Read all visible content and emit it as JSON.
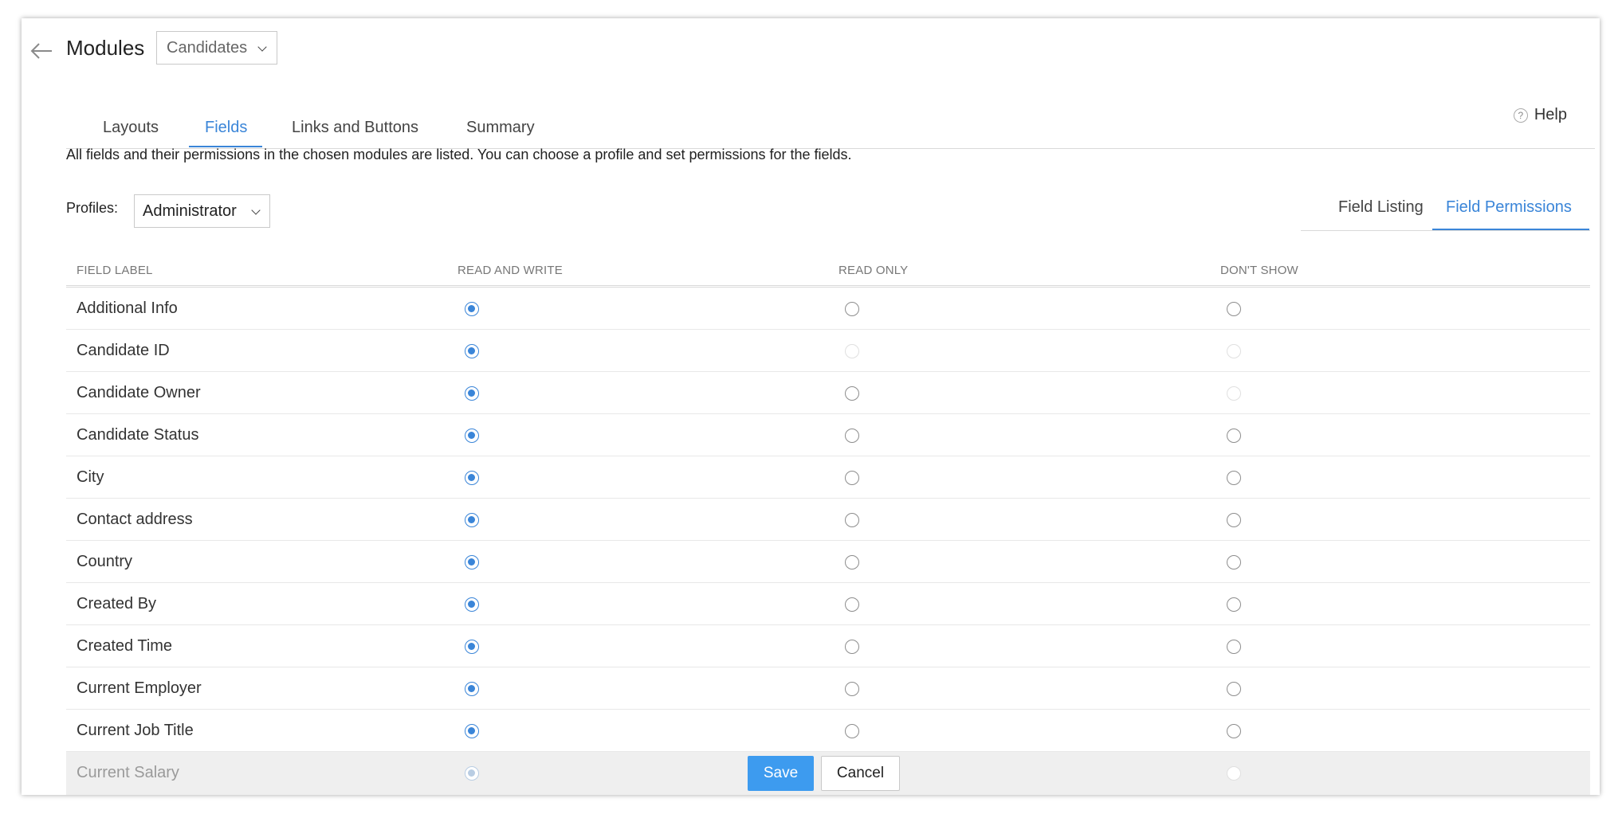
{
  "header": {
    "title": "Modules",
    "module_selected": "Candidates"
  },
  "tabs": [
    {
      "label": "Layouts",
      "active": false
    },
    {
      "label": "Fields",
      "active": true
    },
    {
      "label": "Links and Buttons",
      "active": false
    },
    {
      "label": "Summary",
      "active": false
    }
  ],
  "help": {
    "icon": "question-circle-icon",
    "label": "Help"
  },
  "description": "All fields and their permissions in the chosen modules are listed. You can choose a profile and set permissions for the fields.",
  "profiles": {
    "label": "Profiles:",
    "selected": "Administrator"
  },
  "view_toggle": [
    {
      "label": "Field Listing",
      "active": false
    },
    {
      "label": "Field Permissions",
      "active": true
    }
  ],
  "table": {
    "headers": [
      "FIELD LABEL",
      "READ AND WRITE",
      "READ ONLY",
      "DON'T SHOW"
    ],
    "rows": [
      {
        "label": "Additional Info",
        "selected": "read_write",
        "disabled": []
      },
      {
        "label": "Candidate ID",
        "selected": "read_write",
        "disabled": [
          "read_only",
          "dont_show"
        ]
      },
      {
        "label": "Candidate Owner",
        "selected": "read_write",
        "disabled": [
          "dont_show"
        ]
      },
      {
        "label": "Candidate Status",
        "selected": "read_write",
        "disabled": []
      },
      {
        "label": "City",
        "selected": "read_write",
        "disabled": []
      },
      {
        "label": "Contact address",
        "selected": "read_write",
        "disabled": []
      },
      {
        "label": "Country",
        "selected": "read_write",
        "disabled": []
      },
      {
        "label": "Created By",
        "selected": "read_write",
        "disabled": []
      },
      {
        "label": "Created Time",
        "selected": "read_write",
        "disabled": []
      },
      {
        "label": "Current Employer",
        "selected": "read_write",
        "disabled": []
      },
      {
        "label": "Current Job Title",
        "selected": "read_write",
        "disabled": []
      },
      {
        "label": "Current Salary",
        "selected": "read_write",
        "disabled": [
          "read_write",
          "read_only",
          "dont_show"
        ]
      }
    ]
  },
  "actions": {
    "save_label": "Save",
    "cancel_label": "Cancel"
  },
  "colors": {
    "accent": "#3a85d8",
    "save_button": "#3d9bef",
    "footer_row": "#efefef"
  }
}
